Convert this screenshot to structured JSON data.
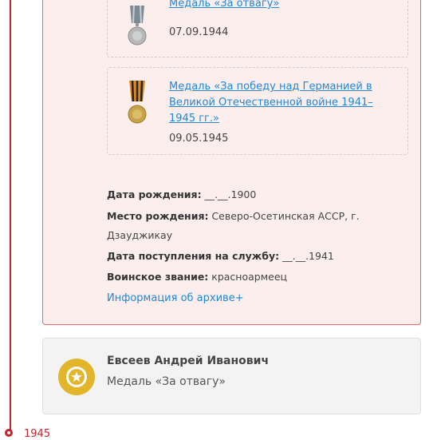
{
  "awards": [
    {
      "title": "Медаль «За отвагу»",
      "date": "07.09.1944"
    },
    {
      "title_lines": [
        "Медаль «За победу над Германией в",
        "Великой Отечественной войне 1941–",
        "1945 гг.»"
      ],
      "date": "09.05.1945"
    }
  ],
  "info": {
    "birth_date_label": "Дата рождения:",
    "birth_date_value": " __.__.1900",
    "birth_place_label": "Место рождения:",
    "birth_place_value_1": " Северо-Осетинская АССР, г.",
    "birth_place_value_2": "Дзауджикау",
    "service_label": "Дата поступления на службу:",
    "service_value": " __.__.1941",
    "rank_label": "Воинское звание:",
    "rank_value": " красноармеец"
  },
  "archive_link": "Информация об архиве+",
  "person": {
    "name": "Евсеев Андрей Иванович",
    "award": "Медаль «За отвагу»"
  },
  "timeline": {
    "year": "1945"
  },
  "colors": {
    "accent": "#c8232c",
    "link": "#1e88d6",
    "card_bg": "#fdeeee",
    "card_border": "#e8646b",
    "medal_gold": "#e2b52a"
  }
}
